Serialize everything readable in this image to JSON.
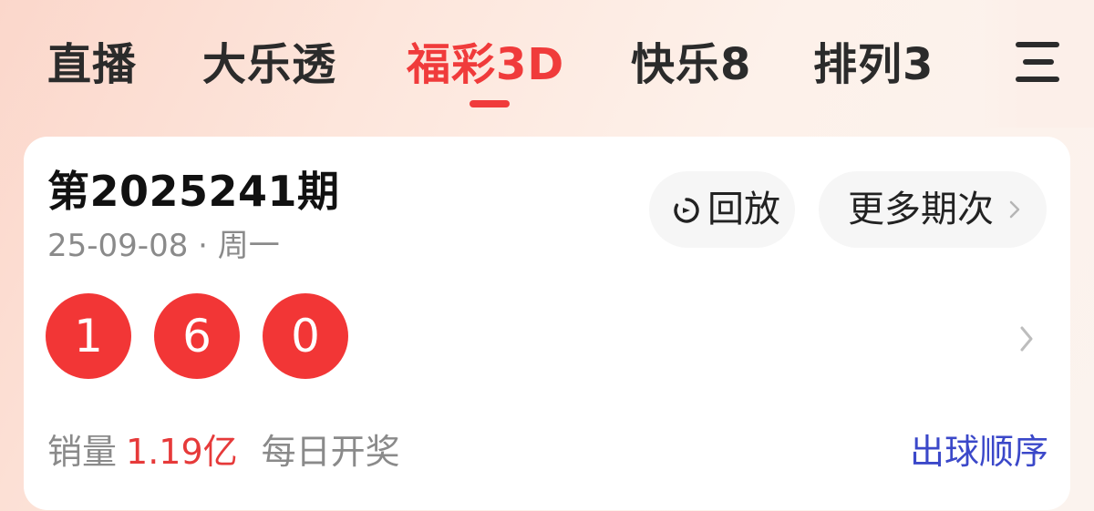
{
  "tabs": [
    {
      "label": "直播",
      "active": false
    },
    {
      "label": "大乐透",
      "active": false
    },
    {
      "label": "福彩3D",
      "active": true
    },
    {
      "label": "快乐8",
      "active": false
    },
    {
      "label": "排列3",
      "active": false
    }
  ],
  "menu_icon": "hamburger-menu-icon",
  "card": {
    "issue_title": "第2025241期",
    "date": "25-09-08 · 周一",
    "replay_label": "回放",
    "replay_icon": "replay-timer-icon",
    "more_label": "更多期次",
    "balls": [
      "1",
      "6",
      "0"
    ],
    "sales_label": "销量",
    "sales_value": "1.19亿",
    "schedule": "每日开奖",
    "draw_order_label": "出球顺序"
  },
  "colors": {
    "accent_red": "#f03b3b",
    "ball_red": "#f23636",
    "link_blue": "#3b48c9"
  }
}
